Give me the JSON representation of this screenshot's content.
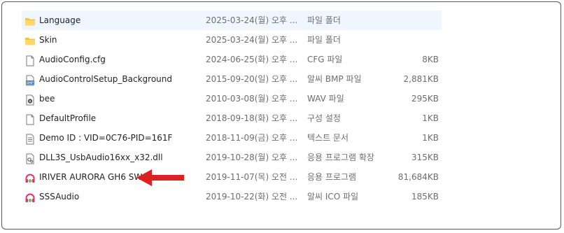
{
  "files": [
    {
      "name": "Language",
      "date": "2025-03-24(월) 오후 ...",
      "type": "파일 폴더",
      "size": "",
      "icon": "folder-icon"
    },
    {
      "name": "Skin",
      "date": "2025-03-24(월) 오후 ...",
      "type": "파일 폴더",
      "size": "",
      "icon": "folder-icon"
    },
    {
      "name": "AudioConfig.cfg",
      "date": "2024-06-25(화) 오후 ...",
      "type": "CFG 파일",
      "size": "8KB",
      "icon": "file-icon"
    },
    {
      "name": "AudioControlSetup_Background",
      "date": "2015-09-20(일) 오후 ...",
      "type": "알씨 BMP 파일",
      "size": "2,881KB",
      "icon": "bmp-image-icon"
    },
    {
      "name": "bee",
      "date": "2010-03-08(월) 오후 ...",
      "type": "WAV 파일",
      "size": "295KB",
      "icon": "audio-file-icon"
    },
    {
      "name": "DefaultProfile",
      "date": "2018-09-18(화) 오후 ...",
      "type": "구성 설정",
      "size": "1KB",
      "icon": "file-icon"
    },
    {
      "name": "Demo ID : VID=0C76-PID=161F",
      "date": "2018-11-09(금) 오후 ...",
      "type": "텍스트 문서",
      "size": "1KB",
      "icon": "text-file-icon"
    },
    {
      "name": "DLL3S_UsbAudio16xx_x32.dll",
      "date": "2019-10-28(월) 오후 ...",
      "type": "응용 프로그램 확장",
      "size": "315KB",
      "icon": "dll-file-icon"
    },
    {
      "name": "IRIVER AURORA GH6 SW",
      "date": "2019-11-07(목) 오전 ...",
      "type": "응용 프로그램",
      "size": "81,684KB",
      "icon": "headphone-app-icon"
    },
    {
      "name": "SSSAudio",
      "date": "2019-10-22(화) 오전 ...",
      "type": "알씨 ICO 파일",
      "size": "185KB",
      "icon": "headphone-ico-icon"
    }
  ],
  "colors": {
    "folder": "#f5c342",
    "arrow": "#e02020",
    "selected_row": "#f0f6ff"
  }
}
